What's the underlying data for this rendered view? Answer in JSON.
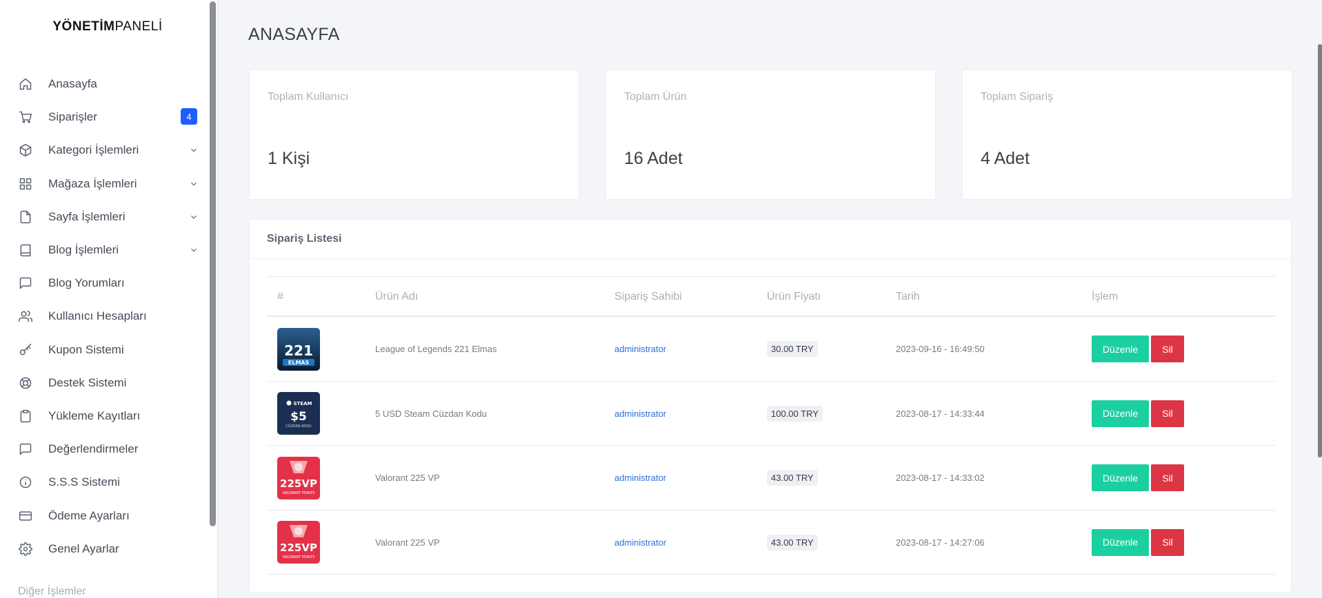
{
  "brand": {
    "bold": "YÖNETİM",
    "light": "PANELİ"
  },
  "sidebar": {
    "items": [
      {
        "label": "Anasayfa",
        "icon": "home-icon"
      },
      {
        "label": "Siparişler",
        "icon": "cart-icon",
        "badge": "4"
      },
      {
        "label": "Kategori İşlemleri",
        "icon": "box-icon",
        "has_submenu": true
      },
      {
        "label": "Mağaza İşlemleri",
        "icon": "grid-icon",
        "has_submenu": true
      },
      {
        "label": "Sayfa İşlemleri",
        "icon": "file-icon",
        "has_submenu": true
      },
      {
        "label": "Blog İşlemleri",
        "icon": "book-icon",
        "has_submenu": true
      },
      {
        "label": "Blog Yorumları",
        "icon": "comment-icon"
      },
      {
        "label": "Kullanıcı Hesapları",
        "icon": "users-icon"
      },
      {
        "label": "Kupon Sistemi",
        "icon": "key-icon"
      },
      {
        "label": "Destek Sistemi",
        "icon": "lifebuoy-icon"
      },
      {
        "label": "Yükleme Kayıtları",
        "icon": "clipboard-icon"
      },
      {
        "label": "Değerlendirmeler",
        "icon": "comment-icon"
      },
      {
        "label": "S.S.S Sistemi",
        "icon": "info-icon"
      },
      {
        "label": "Ödeme Ayarları",
        "icon": "credit-card-icon"
      },
      {
        "label": "Genel Ayarlar",
        "icon": "gear-icon"
      }
    ],
    "section_label": "Diğer İşlemler"
  },
  "page": {
    "title": "ANASAYFA"
  },
  "stats": [
    {
      "label": "Toplam Kullanıcı",
      "value": "1 Kişi"
    },
    {
      "label": "Toplam Ürün",
      "value": "16 Adet"
    },
    {
      "label": "Toplam Sipariş",
      "value": "4 Adet"
    }
  ],
  "orders": {
    "title": "Sipariş Listesi",
    "columns": [
      "#",
      "Ürün Adı",
      "Sipariş Sahibi",
      "Ürün Fiyatı",
      "Tarih",
      "İşlem"
    ],
    "edit_label": "Düzenle",
    "delete_label": "Sil",
    "rows": [
      {
        "thumb": "lol",
        "thumb_text": "221",
        "thumb_sub": "ELMAS",
        "product": "League of Legends 221 Elmas",
        "owner": "administrator",
        "price": "30.00 TRY",
        "date": "2023-09-16 - 16:49:50"
      },
      {
        "thumb": "steam",
        "thumb_text": "$5",
        "thumb_sub": "CÜZDAN KODU",
        "thumb_top": "STEAM",
        "product": "5 USD Steam Cüzdan Kodu",
        "owner": "administrator",
        "price": "100.00 TRY",
        "date": "2023-08-17 - 14:33:44"
      },
      {
        "thumb": "valorant",
        "thumb_text": "225VP",
        "thumb_sub": "VALORANT POINTS",
        "product": "Valorant 225 VP",
        "owner": "administrator",
        "price": "43.00 TRY",
        "date": "2023-08-17 - 14:33:02"
      },
      {
        "thumb": "valorant",
        "thumb_text": "225VP",
        "thumb_sub": "VALORANT POINTS",
        "product": "Valorant 225 VP",
        "owner": "administrator",
        "price": "43.00 TRY",
        "date": "2023-08-17 - 14:27:06"
      }
    ]
  },
  "colors": {
    "accent": "#1e5eff",
    "edit": "#1ccfa0",
    "delete": "#dc3545",
    "link": "#2f6ed8"
  }
}
